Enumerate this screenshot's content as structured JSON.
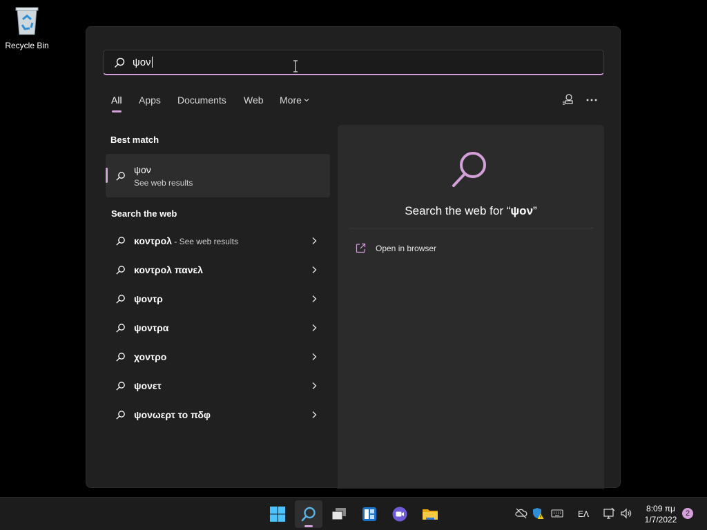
{
  "desktop": {
    "recycle_bin_label": "Recycle Bin"
  },
  "search": {
    "query": "ψον"
  },
  "tabs": [
    {
      "label": "All"
    },
    {
      "label": "Apps"
    },
    {
      "label": "Documents"
    },
    {
      "label": "Web"
    },
    {
      "label": "More"
    }
  ],
  "best_match": {
    "title": "Best match",
    "name": "ψον",
    "subtitle": "See web results"
  },
  "search_web": {
    "title": "Search the web",
    "items": [
      {
        "text": "κοντρολ",
        "suffix": " - See web results"
      },
      {
        "text": "κοντρολ πανελ",
        "suffix": ""
      },
      {
        "text": "ψοντρ",
        "suffix": ""
      },
      {
        "text": "ψοντρα",
        "suffix": ""
      },
      {
        "text": "χοντρο",
        "suffix": ""
      },
      {
        "text": "ψονετ",
        "suffix": ""
      },
      {
        "text": "ψονωερτ το πδφ",
        "suffix": ""
      }
    ]
  },
  "preview": {
    "title_prefix": "Search the web for “",
    "title_query": "ψον",
    "title_suffix": "”",
    "open_in_browser": "Open in browser"
  },
  "taskbar": {
    "language": "ΕΛ",
    "time": "8:09 πμ",
    "date": "1/7/2022",
    "notification_count": "2"
  },
  "colors": {
    "accent": "#d4a0d9",
    "panel": "#202020",
    "preview": "#2b2b2b"
  }
}
